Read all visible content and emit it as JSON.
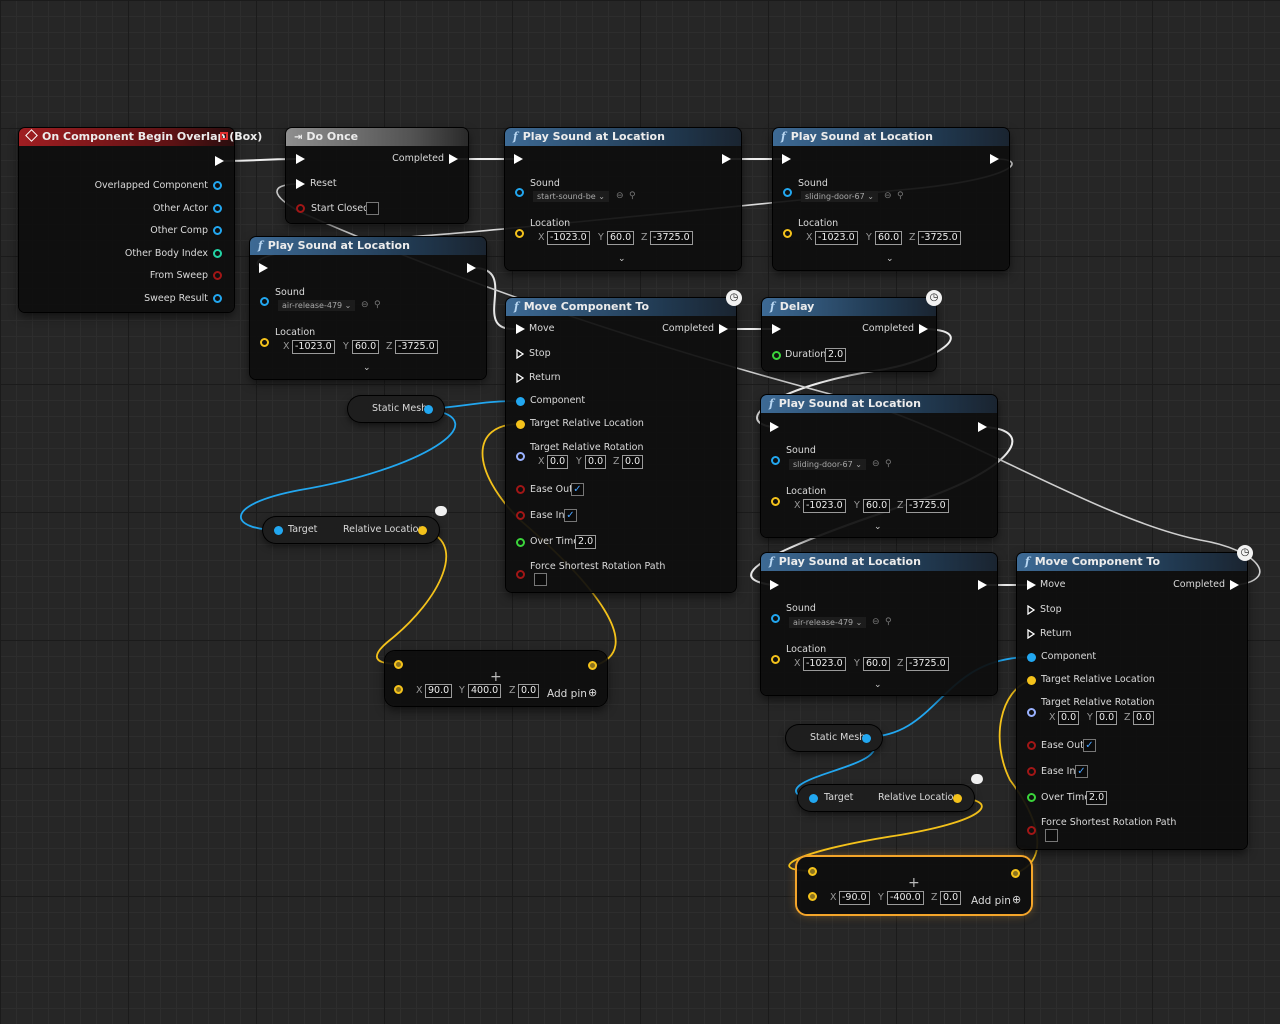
{
  "colors": {
    "exec": "#ffffff",
    "object": "#22a7f0",
    "vector": "#f4c21b",
    "rotator": "#9ab2ff",
    "bool": "#a11616",
    "float": "#3bd43b",
    "selection": "#f4a52a"
  },
  "icons": {
    "event": "diamond-event-icon",
    "function": "function-f-icon",
    "latent": "clock-icon",
    "reroute": "plus-icon",
    "add_pin": "add-circle-icon"
  },
  "nodes": {
    "event_overlap": {
      "title": "On Component Begin Overlap (Box)",
      "pins": [
        "Overlapped Component",
        "Other Actor",
        "Other Comp",
        "Other Body Index",
        "From Sweep",
        "Sweep Result"
      ]
    },
    "do_once": {
      "title": "Do Once",
      "completed": "Completed",
      "reset": "Reset",
      "start_closed": "Start Closed"
    },
    "play_sound_1": {
      "title": "Play Sound at Location",
      "sound_label": "Sound",
      "sound_value": "start-sound-be",
      "location_label": "Location",
      "x": "-1023.0",
      "y": "60.0",
      "z": "-3725.0"
    },
    "play_sound_2": {
      "title": "Play Sound at Location",
      "sound_label": "Sound",
      "sound_value": "sliding-door-67",
      "location_label": "Location",
      "x": "-1023.0",
      "y": "60.0",
      "z": "-3725.0"
    },
    "play_sound_3": {
      "title": "Play Sound at Location",
      "sound_label": "Sound",
      "sound_value": "air-release-479",
      "location_label": "Location",
      "x": "-1023.0",
      "y": "60.0",
      "z": "-3725.0"
    },
    "move_component_1": {
      "title": "Move Component To",
      "move": "Move",
      "completed": "Completed",
      "stop": "Stop",
      "return": "Return",
      "component": "Component",
      "target_rel_loc": "Target Relative Location",
      "target_rel_rot": "Target Relative Rotation",
      "rx": "0.0",
      "ry": "0.0",
      "rz": "0.0",
      "ease_out": "Ease Out",
      "ease_in": "Ease In",
      "over_time": "Over Time",
      "over_time_value": "2.0",
      "force_shortest": "Force Shortest Rotation Path"
    },
    "delay": {
      "title": "Delay",
      "completed": "Completed",
      "duration": "Duration",
      "duration_value": "2.0"
    },
    "play_sound_4": {
      "title": "Play Sound at Location",
      "sound_label": "Sound",
      "sound_value": "sliding-door-67",
      "location_label": "Location",
      "x": "-1023.0",
      "y": "60.0",
      "z": "-3725.0"
    },
    "play_sound_5": {
      "title": "Play Sound at Location",
      "sound_label": "Sound",
      "sound_value": "air-release-479",
      "location_label": "Location",
      "x": "-1023.0",
      "y": "60.0",
      "z": "-3725.0"
    },
    "move_component_2": {
      "title": "Move Component To",
      "move": "Move",
      "completed": "Completed",
      "stop": "Stop",
      "return": "Return",
      "component": "Component",
      "target_rel_loc": "Target Relative Location",
      "target_rel_rot": "Target Relative Rotation",
      "rx": "0.0",
      "ry": "0.0",
      "rz": "0.0",
      "ease_out": "Ease Out",
      "ease_in": "Ease In",
      "over_time": "Over Time",
      "over_time_value": "2.0",
      "force_shortest": "Force Shortest Rotation Path"
    },
    "static_mesh_1": {
      "label": "Static Mesh"
    },
    "static_mesh_2": {
      "label": "Static Mesh"
    },
    "get_rel_loc_1": {
      "target": "Target",
      "output": "Relative Location"
    },
    "get_rel_loc_2": {
      "target": "Target",
      "output": "Relative Location"
    },
    "add_1": {
      "x": "90.0",
      "y": "400.0",
      "z": "0.0",
      "add_pin": "Add pin"
    },
    "add_2": {
      "x": "-90.0",
      "y": "-400.0",
      "z": "0.0",
      "add_pin": "Add pin"
    },
    "axis": {
      "x": "X",
      "y": "Y",
      "z": "Z"
    }
  }
}
